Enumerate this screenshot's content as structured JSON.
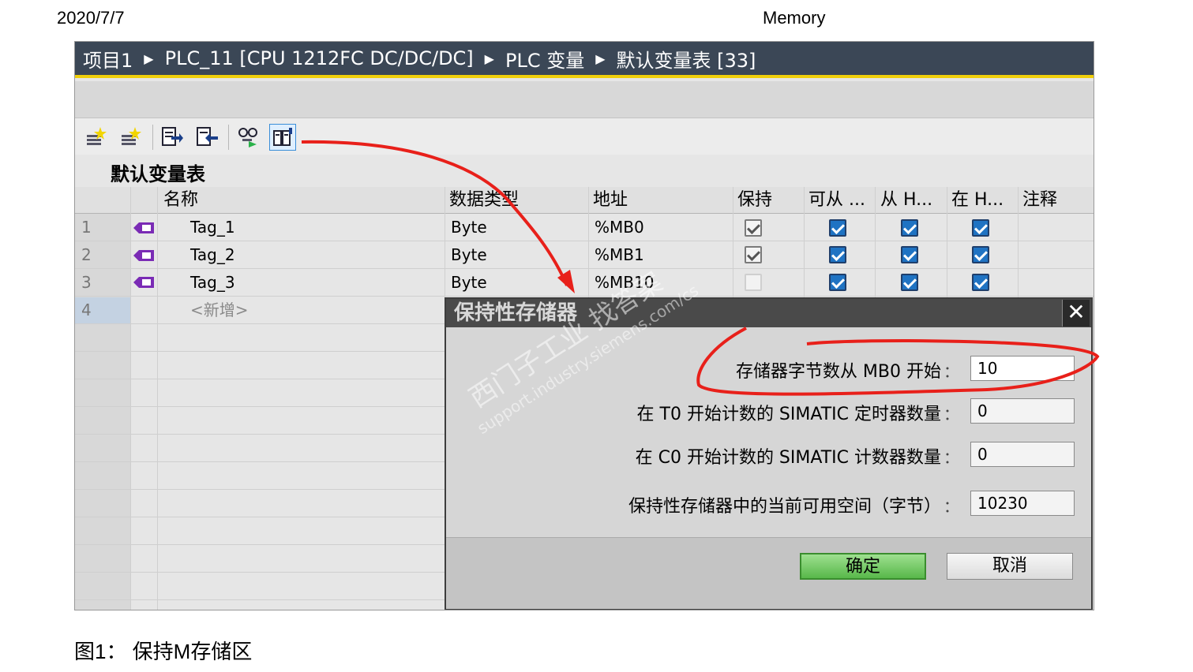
{
  "doc": {
    "date": "2020/7/7",
    "title": "Memory",
    "caption": "图1： 保持M存储区"
  },
  "breadcrumb": [
    "项目1",
    "PLC_11 [CPU 1212FC DC/DC/DC]",
    "PLC 变量",
    "默认变量表 [33]"
  ],
  "breadcrumb_sep": "▶",
  "table_name": "默认变量表",
  "columns": [
    "名称",
    "数据类型",
    "地址",
    "保持",
    "可从 ...",
    "从 H...",
    "在 H...",
    "注释"
  ],
  "rows": [
    {
      "num": "1",
      "name": "Tag_1",
      "type": "Byte",
      "address": "%MB0",
      "retain": true,
      "c1": true,
      "c2": true,
      "c3": true
    },
    {
      "num": "2",
      "name": "Tag_2",
      "type": "Byte",
      "address": "%MB1",
      "retain": true,
      "c1": true,
      "c2": true,
      "c3": true
    },
    {
      "num": "3",
      "name": "Tag_3",
      "type": "Byte",
      "address": "%MB10",
      "retain": false,
      "c1": true,
      "c2": true,
      "c3": true
    }
  ],
  "new_row": {
    "num": "4",
    "label": "<新增>"
  },
  "dialog": {
    "title": "保持性存储器",
    "close": "✕",
    "fields": [
      {
        "label": "存储器字节数从 MB0 开始",
        "value": "10"
      },
      {
        "label": "在 T0 开始计数的 SIMATIC 定时器数量",
        "value": "0"
      },
      {
        "label": "在 C0 开始计数的 SIMATIC 计数器数量",
        "value": "0"
      },
      {
        "label": "保持性存储器中的当前可用空间（字节）",
        "value": "10230"
      }
    ],
    "colon": "：",
    "ok": "确定",
    "cancel": "取消"
  },
  "watermark": {
    "main": "西门子工业 找答案",
    "url": "support.industry.siemens.com/cs"
  },
  "colors": {
    "titlebar": "#3b4756",
    "accent": "#f0cf0a",
    "annotation": "#e8201a",
    "checkbox": "#1f73c3"
  }
}
